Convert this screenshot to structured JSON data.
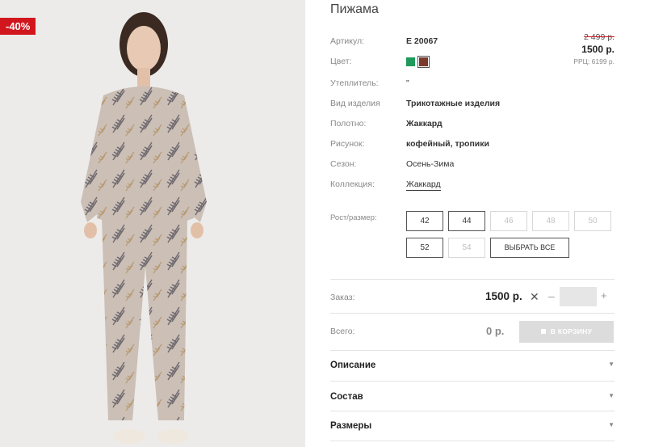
{
  "product": {
    "title": "Пижама",
    "discount_badge": "-40%",
    "price_old": "2 499 р.",
    "price_new": "1500 р.",
    "price_rrp": "РРЦ: 6199 р."
  },
  "attributes": {
    "article_label": "Артикул:",
    "article_value": "Е 20067",
    "color_label": "Цвет:",
    "colors": [
      "#1f9a5a",
      "#7a3a2d"
    ],
    "insulation_label": "Утеплитель:",
    "insulation_value": "\"",
    "type_label": "Вид изделия",
    "type_value": "Трикотажные изделия",
    "fabric_label": "Полотно:",
    "fabric_value": "Жаккард",
    "pattern_label": "Рисунок:",
    "pattern_value": "кофейный, тропики",
    "season_label": "Сезон:",
    "season_value": "Осень-Зима",
    "collection_label": "Коллекция:",
    "collection_value": "Жаккард"
  },
  "sizes": {
    "label": "Рост/размер:",
    "items": [
      {
        "label": "42",
        "available": true
      },
      {
        "label": "44",
        "available": true
      },
      {
        "label": "46",
        "available": false
      },
      {
        "label": "48",
        "available": false
      },
      {
        "label": "50",
        "available": false
      },
      {
        "label": "52",
        "available": true
      },
      {
        "label": "54",
        "available": false
      }
    ],
    "select_all_label": "ВЫБРАТЬ ВСЕ"
  },
  "order": {
    "order_label": "Заказ:",
    "order_price": "1500 р.",
    "quantity_value": "",
    "total_label": "Всего:",
    "total_value": "0 р.",
    "cart_button_label": "В КОРЗИНУ"
  },
  "accordion": [
    {
      "label": "Описание"
    },
    {
      "label": "Состав"
    },
    {
      "label": "Размеры"
    }
  ],
  "icons": {
    "remove": "close-icon",
    "minus": "minus-icon",
    "plus": "plus-icon",
    "cart": "cart-icon",
    "accordion_arrow": "caret-down-icon"
  }
}
